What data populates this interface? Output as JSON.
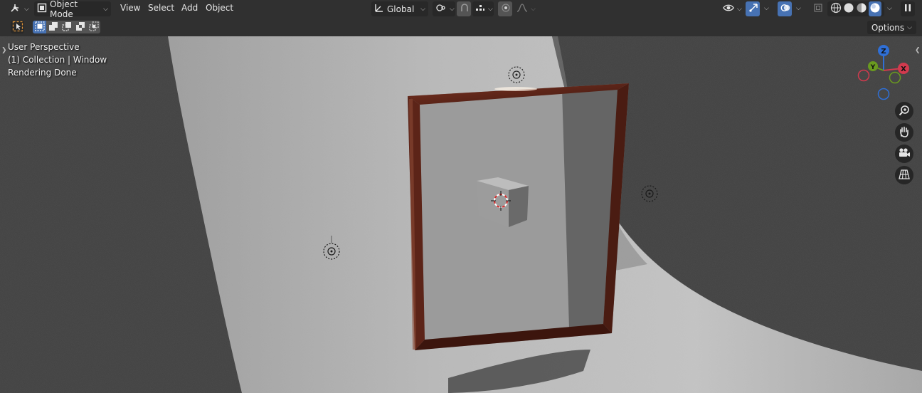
{
  "header": {
    "mode_label": "Object Mode",
    "menu": [
      "View",
      "Select",
      "Add",
      "Object"
    ],
    "transform_orientation": "Global"
  },
  "toolbar": {
    "options_label": "Options"
  },
  "viewport": {
    "overlay_lines": [
      "User Perspective",
      "(1) Collection | Window",
      "Rendering Done"
    ]
  },
  "gizmo": {
    "axes": [
      {
        "label": "Z",
        "color": "#2f6fd6"
      },
      {
        "label": "Y",
        "color": "#6a9a1f"
      },
      {
        "label": "X",
        "color": "#d23a4e"
      }
    ]
  },
  "colors": {
    "header_bg": "#303030",
    "accent_blue": "#4772b3",
    "viewport_bg": "#3d3d3d",
    "frame_wood": "#5c2418",
    "backdrop": "#b5b5b5"
  },
  "icons": [
    "editor-type-icon",
    "object-mode-icon",
    "transform-orientation-icon",
    "pivot-icon",
    "snap-icon",
    "proportional-edit-icon",
    "falloff-icon",
    "visibility-icon",
    "gizmo-icon",
    "overlay-icon",
    "xray-icon",
    "shading-wireframe-icon",
    "shading-solid-icon",
    "shading-material-icon",
    "shading-rendered-icon",
    "zoom-icon",
    "pan-hand-icon",
    "camera-icon",
    "grid-icon",
    "light-icon",
    "camera-origin-icon"
  ]
}
